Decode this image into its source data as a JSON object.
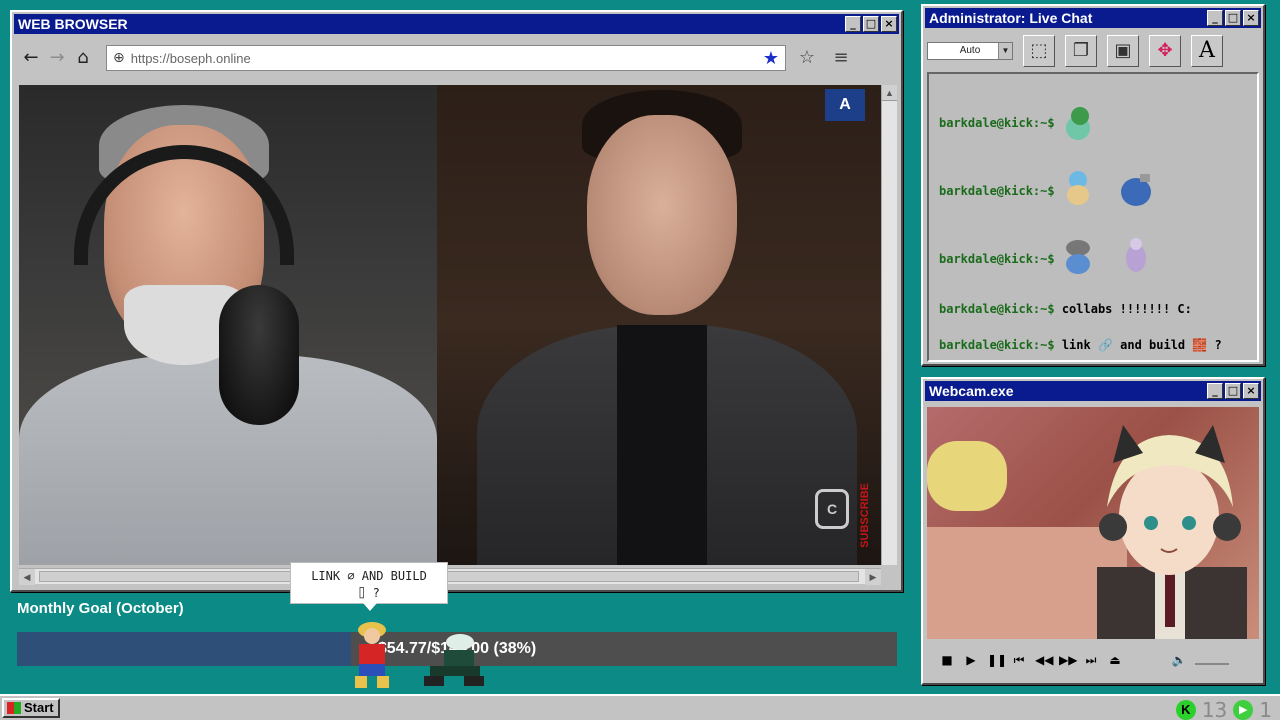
{
  "browser": {
    "title": "WEB BROWSER",
    "url": "https://boseph.online",
    "window_buttons": [
      "_",
      "□",
      "×"
    ]
  },
  "video": {
    "badge": "A",
    "subscribe": "SUBSCRIBE"
  },
  "bubble": {
    "line1": "LINK ⌀ AND BUILD",
    "line2": "⌷ ?"
  },
  "goal": {
    "title": "Monthly Goal (October)",
    "text": "$54.77/$144.00 (38%)",
    "percent": 38
  },
  "chat": {
    "title": "Administrator: Live Chat",
    "mode": "Auto",
    "font_tool": "A",
    "prompt": "barkdale@kick:~$",
    "messages": [
      {
        "text": ""
      },
      {
        "text": ""
      },
      {
        "text": ""
      },
      {
        "text": "collabs !!!!!!! C:"
      },
      {
        "text": "link 🔗 and build 🧱 ?"
      }
    ]
  },
  "webcam": {
    "title": "Webcam.exe"
  },
  "taskbar": {
    "start": "Start",
    "k_label": "K",
    "count1": "13",
    "count2": "1"
  },
  "colors": {
    "desktop": "#0b8a86",
    "titlebar": "#0a1b8f",
    "goal_fill": "#2d4f78"
  }
}
